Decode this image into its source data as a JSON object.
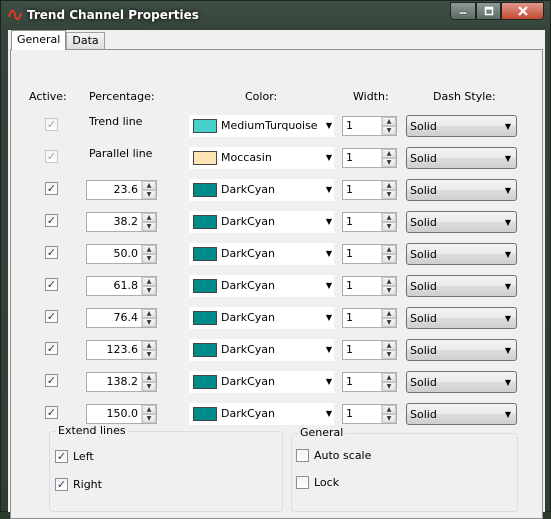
{
  "window": {
    "title": "Trend Channel Properties",
    "accent": "#3f4f44",
    "close_color": "#c44a32"
  },
  "tabs": [
    {
      "label": "General",
      "active": true
    },
    {
      "label": "Data",
      "active": false
    }
  ],
  "headers": {
    "active": "Active:",
    "percentage": "Percentage:",
    "color": "Color:",
    "width": "Width:",
    "dash_style": "Dash Style:"
  },
  "rows": [
    {
      "active": true,
      "enabled": false,
      "label": "Trend line",
      "color_name": "MediumTurquoise",
      "color_hex": "#48d1cc",
      "width": "1",
      "dash": "Solid"
    },
    {
      "active": true,
      "enabled": false,
      "label": "Parallel line",
      "color_name": "Moccasin",
      "color_hex": "#ffe4b5",
      "width": "1",
      "dash": "Solid"
    },
    {
      "active": true,
      "enabled": true,
      "percentage": "23.6",
      "color_name": "DarkCyan",
      "color_hex": "#008b8b",
      "width": "1",
      "dash": "Solid"
    },
    {
      "active": true,
      "enabled": true,
      "percentage": "38.2",
      "color_name": "DarkCyan",
      "color_hex": "#008b8b",
      "width": "1",
      "dash": "Solid"
    },
    {
      "active": true,
      "enabled": true,
      "percentage": "50.0",
      "color_name": "DarkCyan",
      "color_hex": "#008b8b",
      "width": "1",
      "dash": "Solid"
    },
    {
      "active": true,
      "enabled": true,
      "percentage": "61.8",
      "color_name": "DarkCyan",
      "color_hex": "#008b8b",
      "width": "1",
      "dash": "Solid"
    },
    {
      "active": true,
      "enabled": true,
      "percentage": "76.4",
      "color_name": "DarkCyan",
      "color_hex": "#008b8b",
      "width": "1",
      "dash": "Solid"
    },
    {
      "active": true,
      "enabled": true,
      "percentage": "123.6",
      "color_name": "DarkCyan",
      "color_hex": "#008b8b",
      "width": "1",
      "dash": "Solid"
    },
    {
      "active": true,
      "enabled": true,
      "percentage": "138.2",
      "color_name": "DarkCyan",
      "color_hex": "#008b8b",
      "width": "1",
      "dash": "Solid"
    },
    {
      "active": true,
      "enabled": true,
      "percentage": "150.0",
      "color_name": "DarkCyan",
      "color_hex": "#008b8b",
      "width": "1",
      "dash": "Solid"
    }
  ],
  "extend_lines": {
    "title": "Extend lines",
    "left": {
      "label": "Left",
      "checked": true
    },
    "right": {
      "label": "Right",
      "checked": true
    }
  },
  "general_group": {
    "title": "General",
    "auto_scale": {
      "label": "Auto scale",
      "checked": false
    },
    "lock": {
      "label": "Lock",
      "checked": false
    }
  },
  "icons": {
    "app": "trend-curve-icon",
    "minimize": "minimize-icon",
    "maximize": "maximize-icon",
    "close": "close-icon"
  }
}
